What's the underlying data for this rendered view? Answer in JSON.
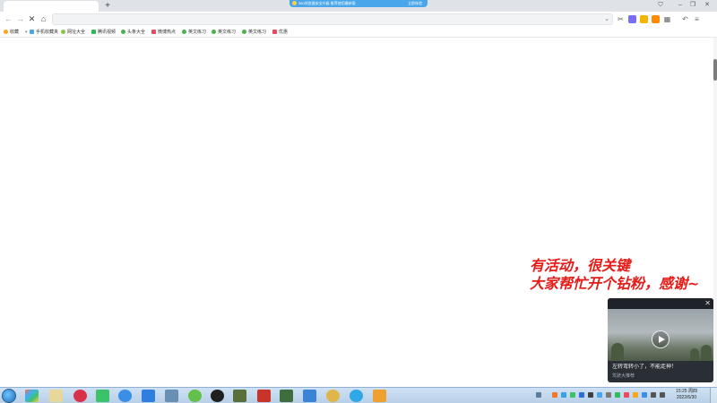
{
  "browser": {
    "new_tab_label": "+",
    "notice": {
      "text": "360浏览器安全升级 推荐使用最新版",
      "button": "立即体验"
    },
    "window_controls": {
      "shield": "⛉",
      "minimize": "–",
      "restore": "❐",
      "close": "✕"
    },
    "nav": {
      "back": "←",
      "forward": "→",
      "stop": "✕",
      "home": "⌂",
      "dropdown": "⌄"
    },
    "address_value": ""
  },
  "bookmarks": [
    {
      "label": "收藏",
      "color": "#f5a623"
    },
    {
      "label": "手机收藏夹",
      "color": "#4aa6ea"
    },
    {
      "label": "网址大全",
      "color": "#8bc34a"
    },
    {
      "label": "腾讯视频",
      "color": "#2ebd59"
    },
    {
      "label": "头条大全",
      "color": "#4caf50"
    },
    {
      "label": "微博热点",
      "color": "#e84a5f"
    },
    {
      "label": "英文练习",
      "color": "#4caf50"
    },
    {
      "label": "英文练习",
      "color": "#4caf50"
    },
    {
      "label": "英文练习",
      "color": "#4caf50"
    },
    {
      "label": "优惠",
      "color": "#e84a5f"
    }
  ],
  "overlay_text": {
    "line1": "有活动，很关键",
    "line2": "大家帮忙开个钻粉，感谢~"
  },
  "video_card": {
    "close": "✕",
    "title": "左转弯转小了，不能走神！",
    "source": "驾驶大推荐"
  },
  "taskbar": {
    "clock_time": "15:25 周四",
    "clock_date": "2022/6/30"
  }
}
